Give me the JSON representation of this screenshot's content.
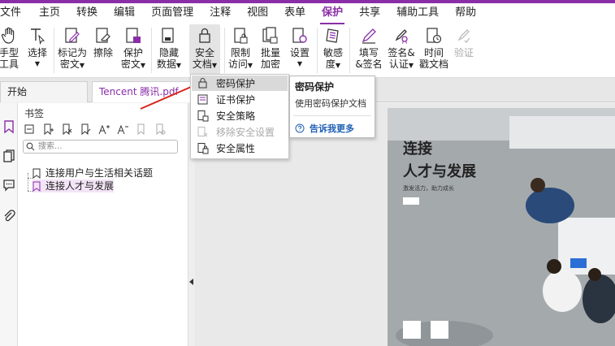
{
  "menu": [
    "文件",
    "主页",
    "转换",
    "编辑",
    "页面管理",
    "注释",
    "视图",
    "表单",
    "保护",
    "共享",
    "辅助工具",
    "帮助"
  ],
  "menu_active": "保护",
  "ribbon": {
    "hand": [
      "手型",
      "工具"
    ],
    "select": [
      "选择"
    ],
    "mark_redact": [
      "标记为",
      "密文"
    ],
    "erase": [
      "擦除"
    ],
    "protect_redact": [
      "保护",
      "密文"
    ],
    "hide_data": [
      "隐藏",
      "数据"
    ],
    "secure_doc": [
      "安全",
      "文档"
    ],
    "restrict": [
      "限制",
      "访问"
    ],
    "batch_encrypt": [
      "批量",
      "加密"
    ],
    "settings": [
      "设置"
    ],
    "sensitivity": [
      "敏感",
      "度"
    ],
    "fill_sign": [
      "填写",
      "&签名"
    ],
    "sign_cert": [
      "签名&",
      "认证"
    ],
    "timestamp": [
      "时间",
      "戳文档"
    ],
    "verify": [
      "验证"
    ]
  },
  "tabs": {
    "start": "开始",
    "doc": "Tencent 腾讯.pdf *"
  },
  "bookmarks": {
    "title": "书签",
    "search_placeholder": "搜索...",
    "items": [
      "连接用户与生活相关话题",
      "连接人才与发展"
    ]
  },
  "dropdown": {
    "items": [
      "密码保护",
      "证书保护",
      "安全策略",
      "移除安全设置",
      "安全属性"
    ]
  },
  "tooltip": {
    "title": "密码保护",
    "desc": "使用密码保护文档",
    "link": "告诉我更多"
  },
  "page": {
    "title1": "连接",
    "title2": "人才与发展",
    "sub": "激发活力，助力成长"
  }
}
